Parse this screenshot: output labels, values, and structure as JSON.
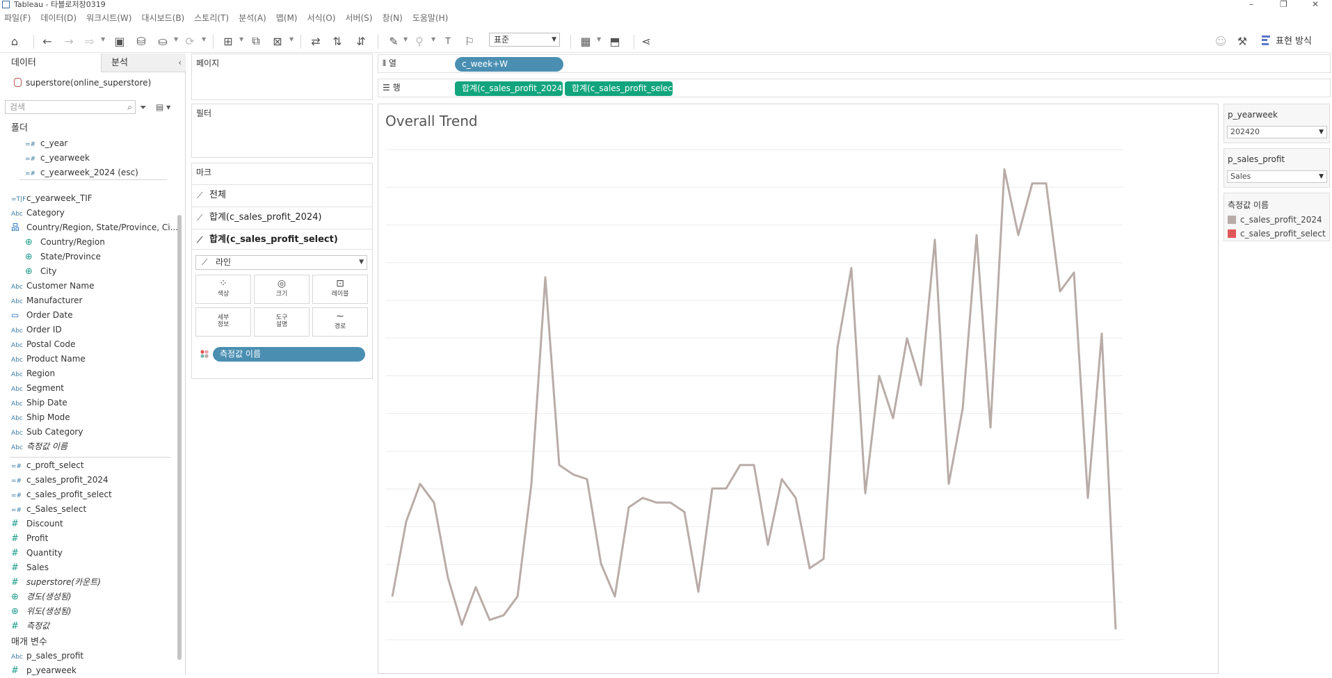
{
  "window": {
    "title": "Tableau - 타블로저장0319",
    "minimize": "–",
    "maximize": "❐",
    "close": "✕"
  },
  "menu": [
    "파일(F)",
    "데이터(D)",
    "워크시트(W)",
    "대시보드(B)",
    "스토리(T)",
    "분석(A)",
    "맵(M)",
    "서식(O)",
    "서버(S)",
    "창(N)",
    "도움말(H)"
  ],
  "toolbar": {
    "zoom": "표준",
    "show_me": "표현 방식"
  },
  "data_pane": {
    "tab_data": "데이터",
    "tab_analysis": "분석",
    "datasource": "superstore(online_superstore)",
    "search_placeholder": "검색",
    "folder_head": "폴더",
    "params_head": "매개 변수",
    "folder_items": [
      {
        "type": "=#",
        "name": "c_year"
      },
      {
        "type": "=#",
        "name": "c_yearweek"
      },
      {
        "type": "=#",
        "name": "c_yearweek_2024 (esc)"
      }
    ],
    "dimensions": [
      {
        "type": "=T|F",
        "name": "c_yearweek_TIF"
      },
      {
        "type": "Abc",
        "name": "Category"
      },
      {
        "type": "hier",
        "name": "Country/Region, State/Province, Ci..."
      },
      {
        "type": "geo",
        "name": "Country/Region"
      },
      {
        "type": "geo",
        "name": "State/Province"
      },
      {
        "type": "geo",
        "name": "City"
      },
      {
        "type": "Abc",
        "name": "Customer Name"
      },
      {
        "type": "Abc",
        "name": "Manufacturer"
      },
      {
        "type": "date",
        "name": "Order Date"
      },
      {
        "type": "Abc",
        "name": "Order ID"
      },
      {
        "type": "Abc",
        "name": "Postal Code"
      },
      {
        "type": "Abc",
        "name": "Product Name"
      },
      {
        "type": "Abc",
        "name": "Region"
      },
      {
        "type": "Abc",
        "name": "Segment"
      },
      {
        "type": "Abc",
        "name": "Ship Date"
      },
      {
        "type": "Abc",
        "name": "Ship Mode"
      },
      {
        "type": "Abc",
        "name": "Sub Category"
      },
      {
        "type": "Abc",
        "name": "측정값 이름"
      }
    ],
    "measures": [
      {
        "type": "=#",
        "name": "c_proft_select"
      },
      {
        "type": "=#",
        "name": "c_sales_profit_2024"
      },
      {
        "type": "=#",
        "name": "c_sales_profit_select"
      },
      {
        "type": "=#",
        "name": "c_Sales_select"
      },
      {
        "type": "#",
        "name": "Discount"
      },
      {
        "type": "#",
        "name": "Profit"
      },
      {
        "type": "#",
        "name": "Quantity"
      },
      {
        "type": "#",
        "name": "Sales"
      },
      {
        "type": "#",
        "name": "superstore(카운트)"
      },
      {
        "type": "geo",
        "name": "경도(생성됨)"
      },
      {
        "type": "geo",
        "name": "위도(생성됨)"
      },
      {
        "type": "#",
        "name": "측정값"
      }
    ],
    "parameters": [
      {
        "type": "Abc",
        "name": "p_sales_profit"
      },
      {
        "type": "#",
        "name": "p_yearweek"
      }
    ]
  },
  "cards": {
    "pages": "페이지",
    "filters": "필터",
    "marks": "마크",
    "marks_all": "전체",
    "marks_row1": "합계(c_sales_profit_2024)",
    "marks_row2": "합계(c_sales_profit_select)",
    "mark_type": "라인",
    "btn_color": "색상",
    "btn_size": "크기",
    "btn_label": "레이블",
    "btn_detail_1": "세부",
    "btn_detail_2": "정보",
    "btn_tooltip_1": "도구",
    "btn_tooltip_2": "설명",
    "btn_path": "경로",
    "measure_names_pill": "측정값 이름"
  },
  "shelves": {
    "columns_label": "열",
    "rows_label": "행",
    "columns_pill": "c_week+W",
    "rows_pill_1": "합계(c_sales_profit_2024)",
    "rows_pill_2": "합계(c_sales_profit_selec.."
  },
  "view": {
    "title": "Overall Trend"
  },
  "side": {
    "param1_title": "p_yearweek",
    "param1_value": "202420",
    "param2_title": "p_sales_profit",
    "param2_value": "Sales",
    "legend_title": "측정값 이름",
    "legend": [
      {
        "name": "c_sales_profit_2024",
        "color": "#b9aca8"
      },
      {
        "name": "c_sales_profit_select",
        "color": "#e05759"
      }
    ]
  },
  "chart_data": {
    "type": "line",
    "title": "Overall Trend",
    "grid": true,
    "ylim": [
      0,
      100
    ],
    "series": [
      {
        "name": "c_sales_profit_2024",
        "color": "#b9aca8",
        "values": [
          7,
          23,
          31,
          27,
          11,
          1,
          9,
          2,
          3,
          7,
          31,
          75,
          35,
          33,
          32,
          14,
          7,
          26,
          28,
          27,
          27,
          25,
          8,
          30,
          30,
          35,
          35,
          18,
          32,
          28,
          13,
          15,
          60,
          77,
          29,
          54,
          45,
          62,
          52,
          83,
          31,
          47,
          84,
          43,
          98,
          84,
          95,
          95,
          72,
          76,
          28,
          63,
          0
        ]
      }
    ]
  }
}
